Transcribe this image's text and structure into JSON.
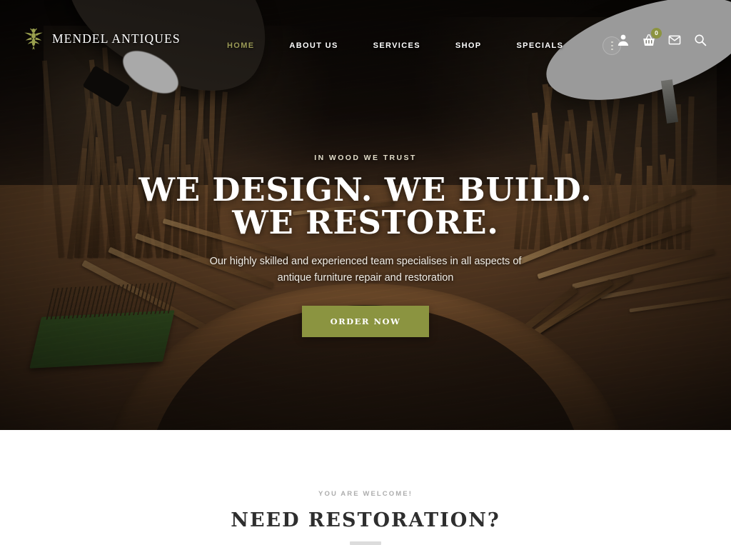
{
  "brand": {
    "name": "MENDEL ANTIQUES",
    "logo_icon": "bee-ornament-icon"
  },
  "nav": {
    "items": [
      {
        "label": "HOME",
        "active": true
      },
      {
        "label": "ABOUT US",
        "active": false
      },
      {
        "label": "SERVICES",
        "active": false
      },
      {
        "label": "SHOP",
        "active": false
      },
      {
        "label": "SPECIALS",
        "active": false
      }
    ],
    "more_icon": "vertical-dots-icon"
  },
  "header_icons": {
    "account_icon": "user-icon",
    "cart_icon": "shopping-basket-icon",
    "cart_count": "0",
    "mail_icon": "envelope-icon",
    "search_icon": "search-icon"
  },
  "hero": {
    "eyebrow": "IN WOOD WE TRUST",
    "title_line1": "WE DESIGN. WE BUILD.",
    "title_line2": "WE RESTORE.",
    "subtitle_line1": "Our highly skilled and experienced team specialises in all aspects of",
    "subtitle_line2": "antique furniture repair and restoration",
    "cta_label": "ORDER NOW"
  },
  "welcome": {
    "eyebrow": "YOU ARE WELCOME!",
    "title": "NEED RESTORATION?"
  },
  "colors": {
    "accent_olive": "#8b9440",
    "nav_active": "#9b9a56",
    "hero_text": "#ffffff",
    "welcome_title": "#2e2e2e",
    "welcome_eyebrow": "#adadad",
    "divider": "#dcdcdc",
    "page_background": "#ffffff"
  }
}
